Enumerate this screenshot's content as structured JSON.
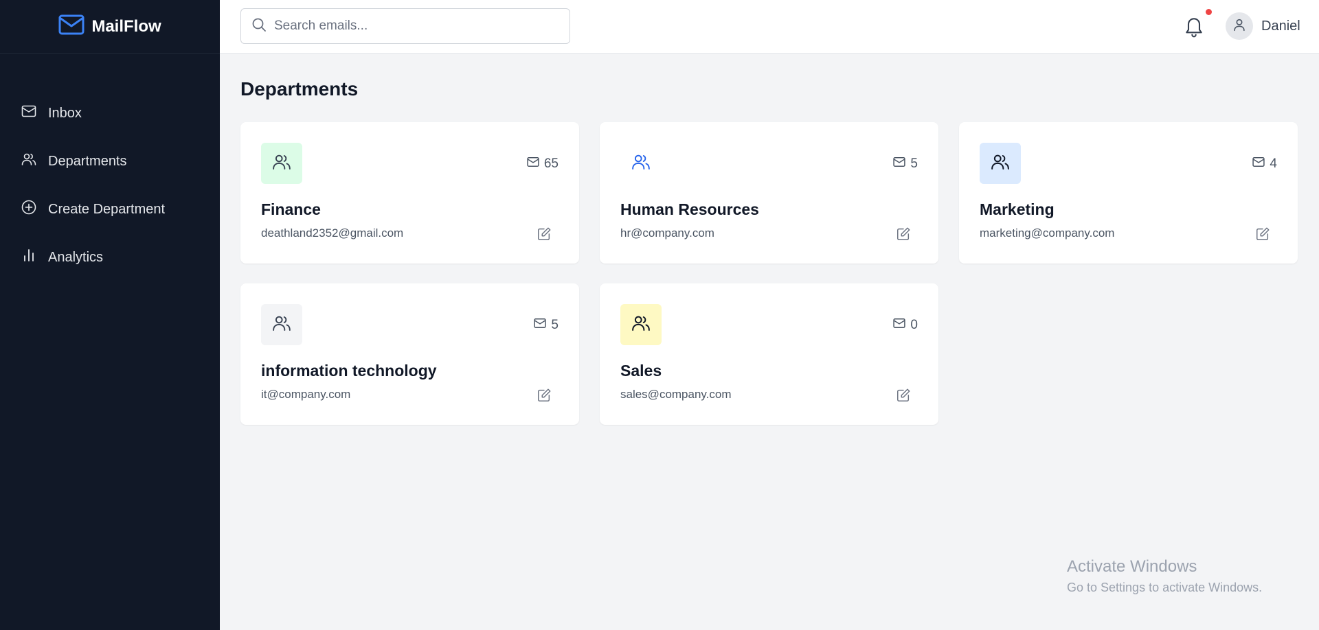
{
  "app": {
    "name": "MailFlow"
  },
  "sidebar": {
    "items": [
      {
        "label": "Inbox",
        "icon": "mail-icon"
      },
      {
        "label": "Departments",
        "icon": "users-icon"
      },
      {
        "label": "Create Department",
        "icon": "plus-circle-icon"
      },
      {
        "label": "Analytics",
        "icon": "bar-chart-icon"
      }
    ]
  },
  "header": {
    "search_placeholder": "Search emails...",
    "user_name": "Daniel",
    "has_notification": true
  },
  "page": {
    "title": "Departments"
  },
  "departments": [
    {
      "name": "Finance",
      "email": "deathland2352@gmail.com",
      "count": "65",
      "icon_bg": "#dcfce7",
      "icon_color": "#374151"
    },
    {
      "name": "Human Resources",
      "email": "hr@company.com",
      "count": "5",
      "icon_bg": "#ffffff",
      "icon_color": "#2563eb"
    },
    {
      "name": "Marketing",
      "email": "marketing@company.com",
      "count": "4",
      "icon_bg": "#dbeafe",
      "icon_color": "#111827"
    },
    {
      "name": "information technology",
      "email": "it@company.com",
      "count": "5",
      "icon_bg": "#f3f4f6",
      "icon_color": "#374151"
    },
    {
      "name": "Sales",
      "email": "sales@company.com",
      "count": "0",
      "icon_bg": "#fef9c3",
      "icon_color": "#111827"
    }
  ],
  "watermark": {
    "title": "Activate Windows",
    "subtitle": "Go to Settings to activate Windows."
  },
  "colors": {
    "sidebar_bg": "#111827",
    "accent": "#3b82f6",
    "notification_dot": "#ef4444",
    "page_bg": "#f3f4f6"
  }
}
